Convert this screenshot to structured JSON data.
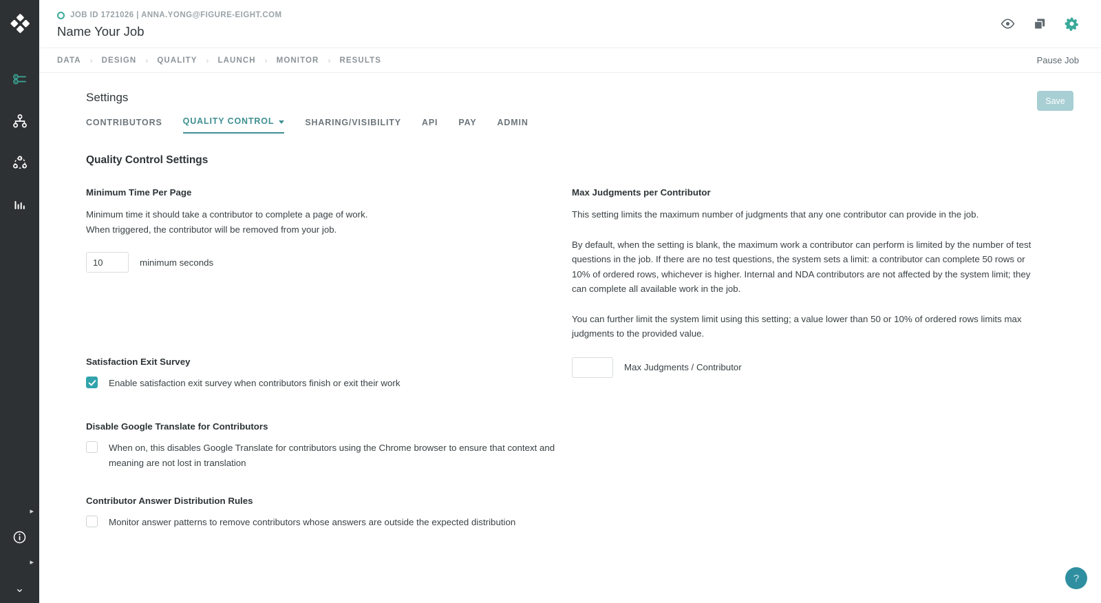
{
  "colors": {
    "accent_teal": "#3aa99a",
    "tab_active": "#3f8f91",
    "checkbox_on": "#31a3ac",
    "save_disabled": "#a8cfd3",
    "rail_bg": "#2e3133",
    "help_fab": "#2f8fa0"
  },
  "rail": {
    "logo_name": "figure-eight-logo",
    "items": [
      {
        "name": "sidebar-item-job-list",
        "icon": "list-settings-icon",
        "active": true
      },
      {
        "name": "sidebar-item-workflow",
        "icon": "hierarchy-icon",
        "active": false
      },
      {
        "name": "sidebar-item-connections",
        "icon": "network-nodes-icon",
        "active": false
      },
      {
        "name": "sidebar-item-analytics",
        "icon": "bar-chart-icon",
        "active": false
      }
    ],
    "bottom": {
      "expand_arrow": "▸",
      "info_icon": "info-icon",
      "collapse_chevron": "⌄"
    }
  },
  "header": {
    "job_meta": "JOB ID 1721026 | ANNA.YONG@FIGURE-EIGHT.COM",
    "job_title": "Name Your Job",
    "status_dot_name": "job-status-dot",
    "actions": [
      {
        "name": "preview-job-icon",
        "icon": "eye-icon"
      },
      {
        "name": "copy-job-icon",
        "icon": "copy-icon"
      },
      {
        "name": "job-settings-icon",
        "icon": "gear-icon"
      }
    ]
  },
  "breadcrumbs": {
    "separator": "›",
    "items": [
      {
        "label": "DATA"
      },
      {
        "label": "DESIGN"
      },
      {
        "label": "QUALITY"
      },
      {
        "label": "LAUNCH"
      },
      {
        "label": "MONITOR"
      },
      {
        "label": "RESULTS"
      }
    ],
    "pause_job_label": "Pause Job"
  },
  "settings": {
    "page_title": "Settings",
    "save_label": "Save",
    "tabs": [
      {
        "label": "CONTRIBUTORS",
        "active": false,
        "has_caret": false
      },
      {
        "label": "QUALITY CONTROL",
        "active": true,
        "has_caret": true
      },
      {
        "label": "SHARING/VISIBILITY",
        "active": false,
        "has_caret": false
      },
      {
        "label": "API",
        "active": false,
        "has_caret": false
      },
      {
        "label": "PAY",
        "active": false,
        "has_caret": false
      },
      {
        "label": "ADMIN",
        "active": false,
        "has_caret": false
      }
    ],
    "section_title": "Quality Control Settings"
  },
  "min_time": {
    "title": "Minimum Time Per Page",
    "desc_line1": "Minimum time it should take a contributor to complete a page of work.",
    "desc_line2": "When triggered, the contributor will be removed from your job.",
    "input_value": "10",
    "input_placeholder": "",
    "unit_label": "minimum seconds"
  },
  "max_judgments": {
    "title": "Max Judgments per Contributor",
    "p1": "This setting limits the maximum number of judgments that any one contributor can provide in the job.",
    "p2": "By default, when the setting is blank, the maximum work a contributor can perform is limited by the number of test questions in the job. If there are no test questions, the system sets a limit: a contributor can complete 50 rows or 10% of ordered rows, whichever is higher. Internal and NDA contributors are not affected by the system limit; they can complete all available work in the job.",
    "p3": "You can further limit the system limit using this setting; a value lower than 50 or 10% of ordered rows limits max judgments to the provided value.",
    "input_value": "",
    "input_placeholder": "",
    "field_label": "Max Judgments / Contributor"
  },
  "exit_survey": {
    "title": "Satisfaction Exit Survey",
    "checkbox_label": "Enable satisfaction exit survey when contributors finish or exit their work",
    "checked": true
  },
  "google_translate": {
    "title": "Disable Google Translate for Contributors",
    "checkbox_label": "When on, this disables Google Translate for contributors using the Chrome browser to ensure that context and meaning are not lost in translation",
    "checked": false
  },
  "answer_distribution": {
    "title": "Contributor Answer Distribution Rules",
    "checkbox_label": "Monitor answer patterns to remove contributors whose answers are outside the expected distribution",
    "checked": false
  },
  "help": {
    "label": "?"
  }
}
